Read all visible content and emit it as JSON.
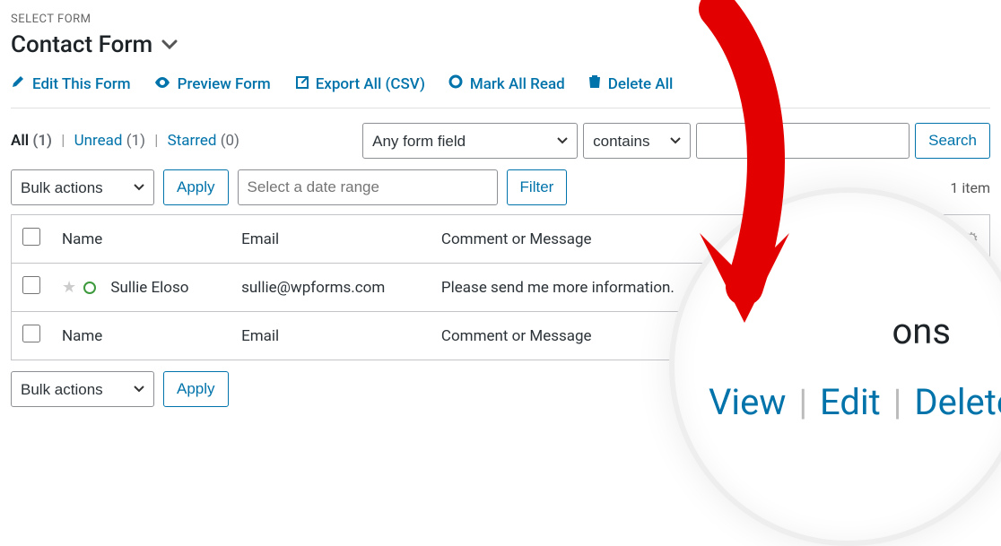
{
  "select_form_label": "SELECT FORM",
  "form_title": "Contact Form",
  "toolbar": {
    "edit": "Edit This Form",
    "preview": "Preview Form",
    "export": "Export All (CSV)",
    "mark_read": "Mark All Read",
    "delete_all": "Delete All"
  },
  "views": {
    "all_label": "All",
    "all_count": "(1)",
    "unread_label": "Unread",
    "unread_count": "(1)",
    "starred_label": "Starred",
    "starred_count": "(0)"
  },
  "search": {
    "field_selected": "Any form field",
    "condition_selected": "contains",
    "input_value": "",
    "button": "Search"
  },
  "bulk": {
    "selected": "Bulk actions",
    "apply": "Apply",
    "date_placeholder": "Select a date range",
    "filter": "Filter"
  },
  "pagination": {
    "items_text": "1 item"
  },
  "columns": {
    "name": "Name",
    "email": "Email",
    "message": "Comment or Message"
  },
  "rows": [
    {
      "name": "Sullie Eloso",
      "email": "sullie@wpforms.com",
      "message": "Please send me more information."
    }
  ],
  "magnifier": {
    "title_fragment": "ons",
    "view": "View",
    "edit": "Edit",
    "delete": "Delete",
    "items": "1 item"
  }
}
